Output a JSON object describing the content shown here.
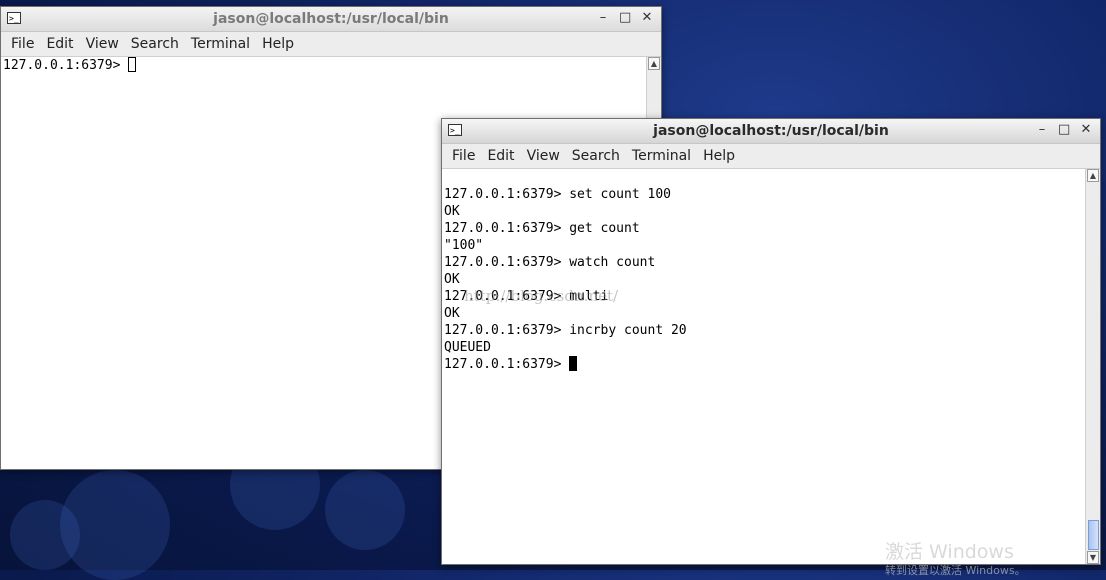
{
  "windows": {
    "back": {
      "title": "jason@localhost:/usr/local/bin",
      "icon_glyph": ">_",
      "menu": [
        "File",
        "Edit",
        "View",
        "Search",
        "Terminal",
        "Help"
      ],
      "lines": [
        "127.0.0.1:6379> "
      ]
    },
    "front": {
      "title": "jason@localhost:/usr/local/bin",
      "icon_glyph": ">_",
      "menu": [
        "File",
        "Edit",
        "View",
        "Search",
        "Terminal",
        "Help"
      ],
      "lines": [
        "127.0.0.1:6379> set count 100",
        "OK",
        "127.0.0.1:6379> get count",
        "\"100\"",
        "127.0.0.1:6379> watch count",
        "OK",
        "127.0.0.1:6379> multi",
        "OK",
        "127.0.0.1:6379> incrby count 20",
        "QUEUED"
      ],
      "prompt": "127.0.0.1:6379> "
    }
  },
  "window_controls": {
    "minimize": "–",
    "maximize": "□",
    "close": "✕"
  },
  "watermark": "http://blog.csdn.net/",
  "activation": {
    "line1": "激活 Windows",
    "line2": "转到设置以激活 Windows。"
  },
  "icons": {
    "terminal": "terminal-icon",
    "scroll_up": "arrow-up-icon",
    "scroll_down": "arrow-down-icon"
  }
}
